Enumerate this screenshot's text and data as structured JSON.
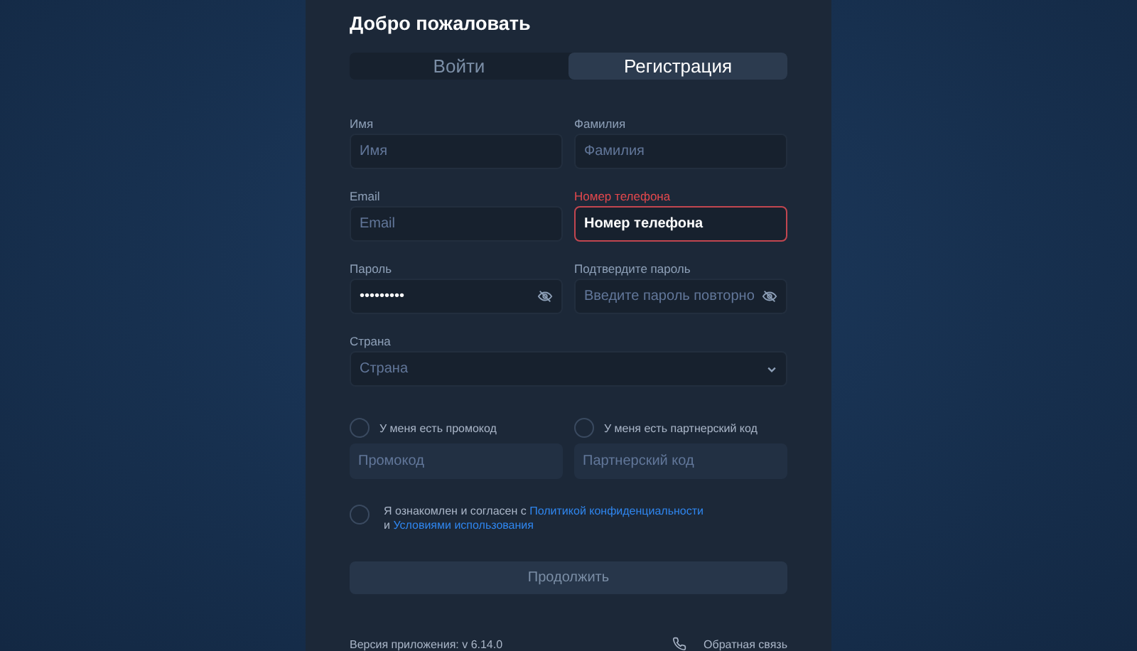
{
  "title": "Добро пожаловать",
  "tabs": [
    {
      "label": "Войти",
      "selected": false
    },
    {
      "label": "Регистрация",
      "selected": true
    }
  ],
  "fields": [
    {
      "kind": "text",
      "label": "Имя",
      "placeholder": "Имя",
      "error": false
    },
    {
      "kind": "text",
      "label": "Фамилия",
      "placeholder": "Фамилия",
      "error": false
    },
    {
      "kind": "text",
      "label": "Email",
      "placeholder": "Email",
      "error": false
    },
    {
      "kind": "text",
      "label": "Номер телефона",
      "value": "Номер телефона",
      "error": true
    },
    {
      "kind": "password",
      "label": "Пароль",
      "value": "•••••••••",
      "error": false
    },
    {
      "kind": "password",
      "label": "Подтвердите пароль",
      "placeholder": "Введите пароль повторно",
      "error": false
    },
    {
      "kind": "select",
      "label": "Страна",
      "placeholder": "Страна",
      "error": false
    }
  ],
  "codes": [
    {
      "label": "У меня есть промокод",
      "checked": false,
      "placeholder": "Промокод"
    },
    {
      "label": "У меня есть партнерский код",
      "checked": false,
      "placeholder": "Партнерский код"
    }
  ],
  "consent": {
    "checked": false,
    "text_before": "Я ознакомлен и согласен с",
    "link_1": "Политикой конфиденциальности",
    "text_between": "и",
    "link_2": "Условиями использования"
  },
  "submit": {
    "label": "Продолжить",
    "disabled": true
  },
  "footer": {
    "version": "Версия приложения: v 6.14.0",
    "feedback": "Обратная связь"
  }
}
